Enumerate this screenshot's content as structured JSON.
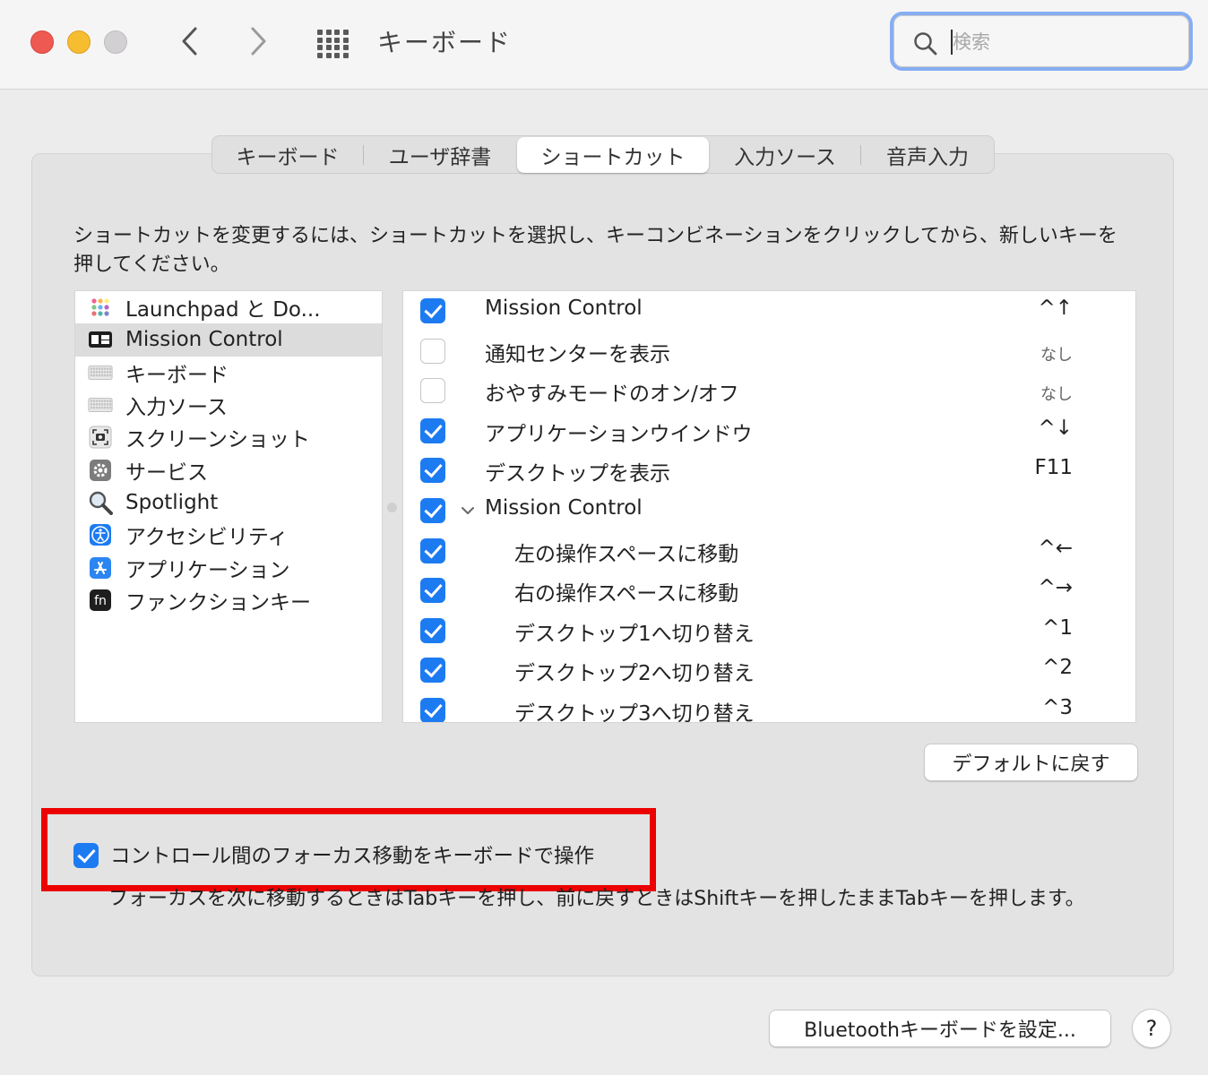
{
  "window": {
    "title": "キーボード",
    "search_placeholder": "検索"
  },
  "tabs": [
    {
      "label": "キーボード",
      "selected": false
    },
    {
      "label": "ユーザ辞書",
      "selected": false
    },
    {
      "label": "ショートカット",
      "selected": true
    },
    {
      "label": "入力ソース",
      "selected": false
    },
    {
      "label": "音声入力",
      "selected": false
    }
  ],
  "description": "ショートカットを変更するには、ショートカットを選択し、キーコンビネーションをクリックしてから、新しいキーを押してください。",
  "categories": [
    {
      "label": "Launchpad と Do...",
      "icon": "launchpad-icon",
      "selected": false
    },
    {
      "label": "Mission Control",
      "icon": "mission-control-icon",
      "selected": true
    },
    {
      "label": "キーボード",
      "icon": "keyboard-icon",
      "selected": false
    },
    {
      "label": "入力ソース",
      "icon": "keyboard-icon",
      "selected": false
    },
    {
      "label": "スクリーンショット",
      "icon": "screenshot-icon",
      "selected": false
    },
    {
      "label": "サービス",
      "icon": "gear-icon",
      "selected": false
    },
    {
      "label": "Spotlight",
      "icon": "magnifier-icon",
      "selected": false
    },
    {
      "label": "アクセシビリティ",
      "icon": "accessibility-icon",
      "selected": false
    },
    {
      "label": "アプリケーション",
      "icon": "app-store-icon",
      "selected": false
    },
    {
      "label": "ファンクションキー",
      "icon": "fn-icon",
      "selected": false
    }
  ],
  "shortcuts": [
    {
      "label": "Mission Control",
      "key": "^↑",
      "checked": true,
      "indent": 0
    },
    {
      "label": "通知センターを表示",
      "key": "なし",
      "checked": false,
      "indent": 0,
      "none": true
    },
    {
      "label": "おやすみモードのオン/オフ",
      "key": "なし",
      "checked": false,
      "indent": 0,
      "none": true
    },
    {
      "label": "アプリケーションウインドウ",
      "key": "^↓",
      "checked": true,
      "indent": 0
    },
    {
      "label": "デスクトップを表示",
      "key": "F11",
      "checked": true,
      "indent": 0
    },
    {
      "label": "Mission Control",
      "key": "",
      "checked": true,
      "indent": 0,
      "group": true
    },
    {
      "label": "左の操作スペースに移動",
      "key": "^←",
      "checked": true,
      "indent": 1
    },
    {
      "label": "右の操作スペースに移動",
      "key": "^→",
      "checked": true,
      "indent": 1
    },
    {
      "label": "デスクトップ1へ切り替え",
      "key": "^1",
      "checked": true,
      "indent": 1
    },
    {
      "label": "デスクトップ2へ切り替え",
      "key": "^2",
      "checked": true,
      "indent": 1
    },
    {
      "label": "デスクトップ3へ切り替え",
      "key": "^3",
      "checked": true,
      "indent": 1
    }
  ],
  "restore_default_label": "デフォルトに戻す",
  "focus_keyboard": {
    "label": "コントロール間のフォーカス移動をキーボードで操作",
    "checked": true,
    "description": "フォーカスを次に移動するときはTabキーを押し、前に戻すときはShiftキーを押したままTabキーを押します。"
  },
  "bluetooth_button_label": "Bluetoothキーボードを設定...",
  "help_label": "?",
  "colors": {
    "accent": "#1d7bf2",
    "highlight_box": "#ec0000",
    "search_focus": "#86aef3"
  }
}
